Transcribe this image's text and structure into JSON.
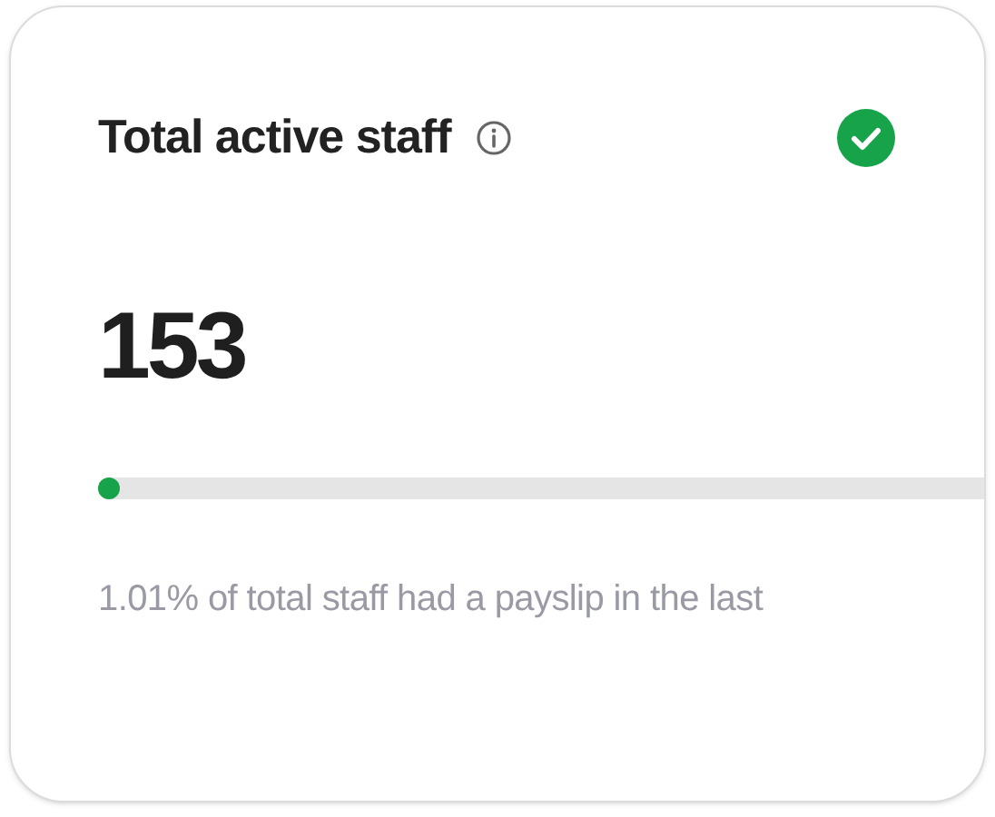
{
  "card": {
    "title": "Total active staff",
    "verified": true,
    "value": "153",
    "progress": {
      "level": 0.0101
    },
    "caption": "1.01% of total staff had a payslip in the last"
  }
}
